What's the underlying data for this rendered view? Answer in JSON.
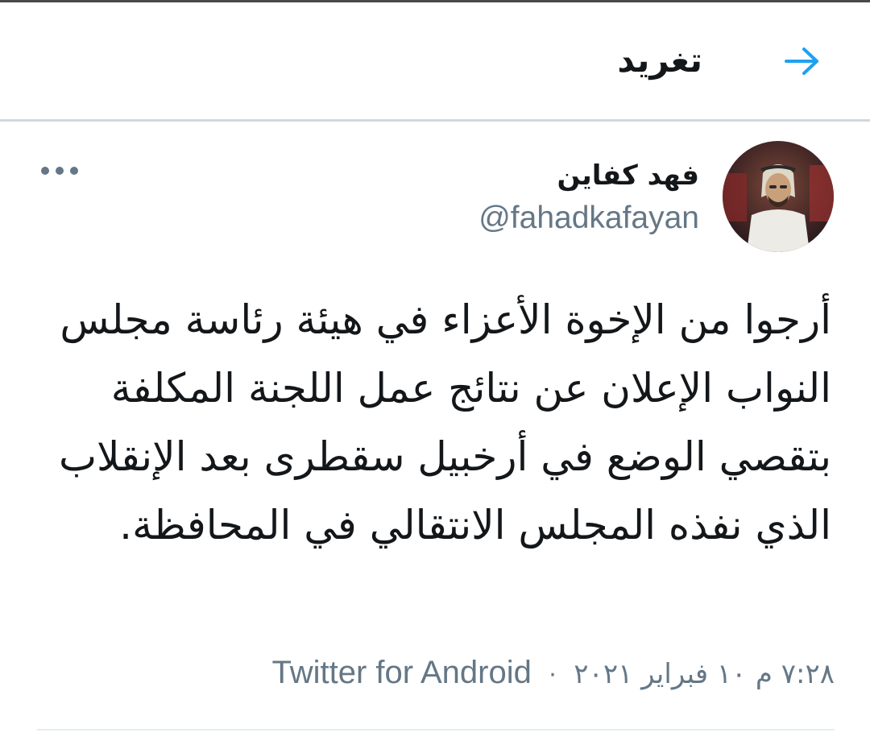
{
  "header": {
    "title": "تغريد",
    "back_icon": "arrow-right-icon",
    "accent_color": "#1da1f2"
  },
  "tweet": {
    "author": {
      "display_name": "فهد كفاين",
      "handle": "@fahadkafayan",
      "avatar_icon": "user-avatar-photo"
    },
    "more_icon": "more-dots-icon",
    "text": "أرجوا من الإخوة الأعزاء في هيئة رئاسة مجلس النواب الإعلان عن نتائج عمل اللجنة المكلفة بتقصي الوضع في أرخبيل سقطرى بعد الإنقلاب الذي نفذه المجلس الانتقالي في المحافظة.",
    "time": "٧:٢٨ م",
    "date": "١٠ فبراير ٢٠٢١",
    "separator": "·",
    "source": "Twitter for Android"
  }
}
